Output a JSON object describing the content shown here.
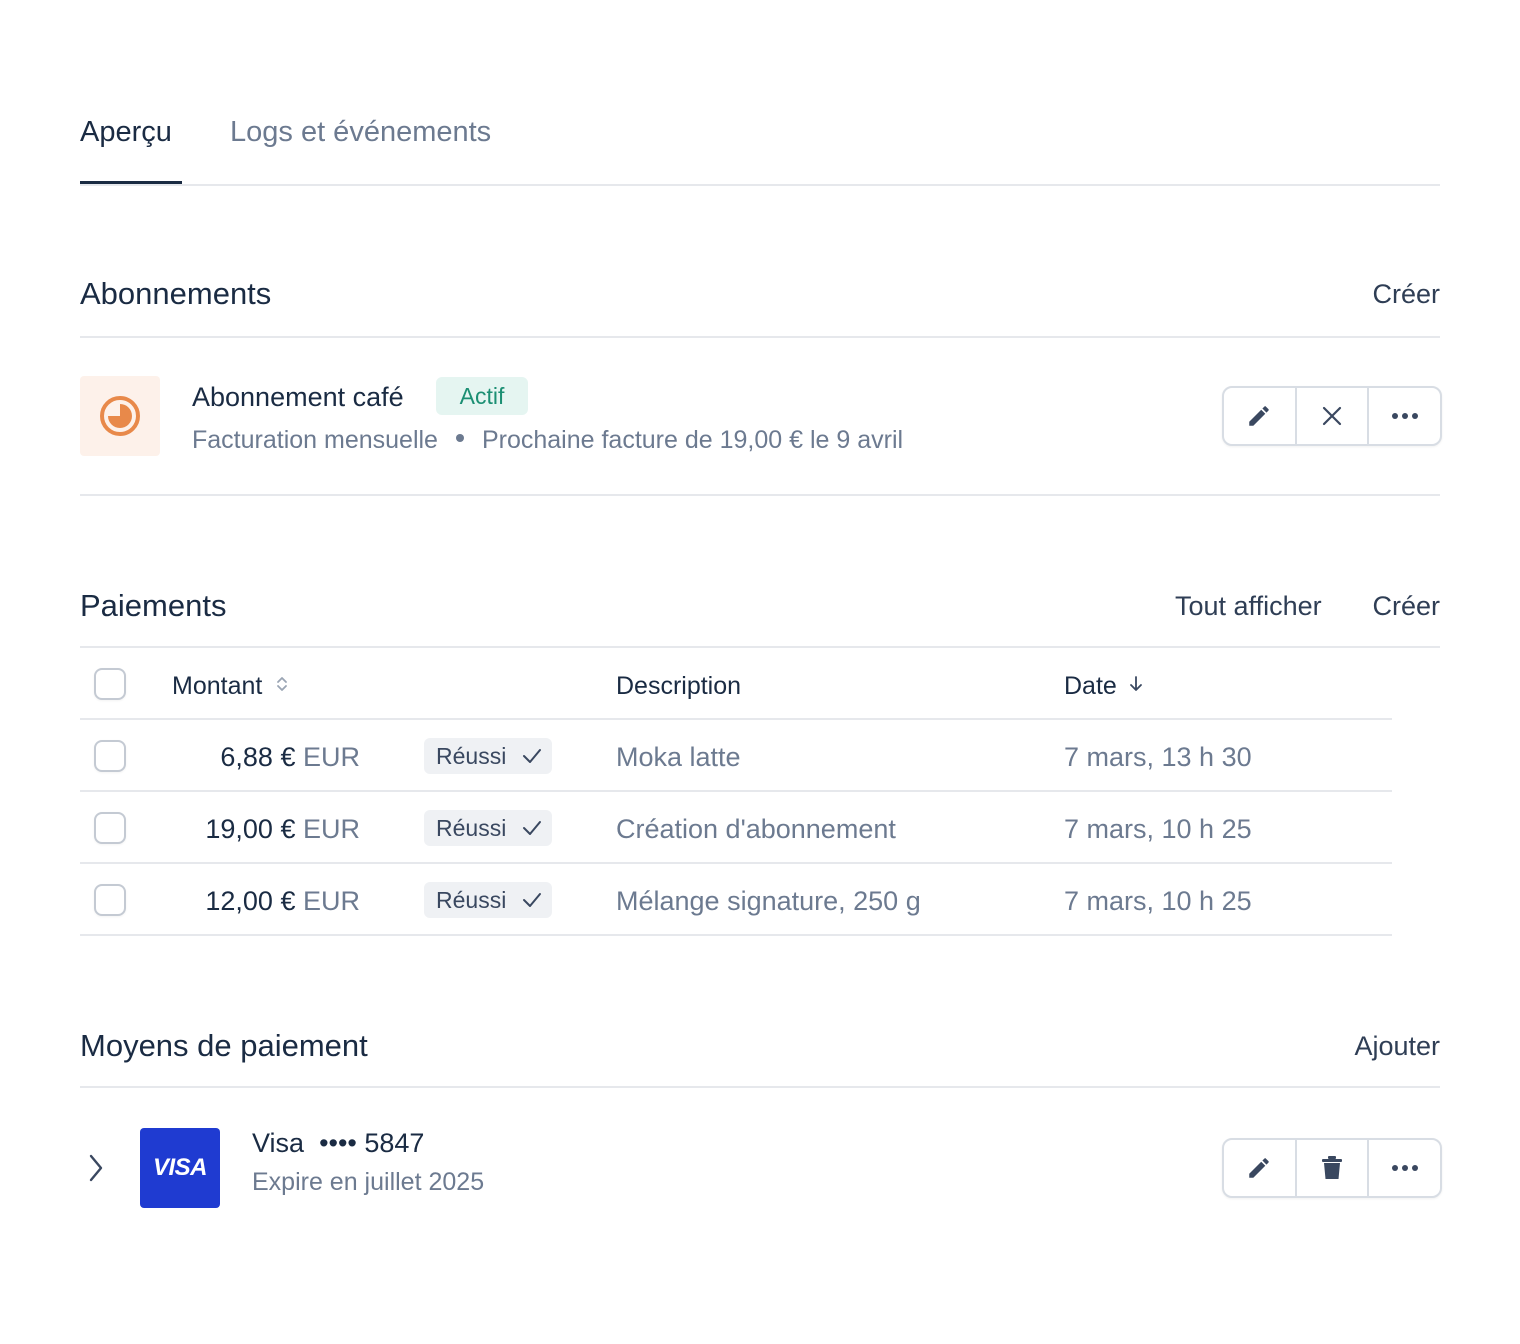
{
  "tabs": [
    {
      "label": "Aperçu",
      "active": true
    },
    {
      "label": "Logs et événements",
      "active": false
    }
  ],
  "subscriptions": {
    "title": "Abonnements",
    "create_label": "Créer",
    "item": {
      "name": "Abonnement café",
      "status": "Actif",
      "billing": "Facturation mensuelle",
      "next_invoice": "Prochaine facture de 19,00 € le 9 avril",
      "actions": [
        "pencil-icon",
        "close-icon",
        "more-icon"
      ]
    }
  },
  "payments": {
    "title": "Paiements",
    "view_all_label": "Tout afficher",
    "create_label": "Créer",
    "columns": {
      "amount": "Montant",
      "description": "Description",
      "date": "Date"
    },
    "rows": [
      {
        "amount": "6,88 €",
        "currency": "EUR",
        "status": "Réussi",
        "description": "Moka latte",
        "date": "7 mars, 13 h 30"
      },
      {
        "amount": "19,00 €",
        "currency": "EUR",
        "status": "Réussi",
        "description": "Création d'abonnement",
        "date": "7 mars, 10 h 25"
      },
      {
        "amount": "12,00 €",
        "currency": "EUR",
        "status": "Réussi",
        "description": "Mélange signature, 250 g",
        "date": "7 mars, 10 h 25"
      }
    ]
  },
  "payment_methods": {
    "title": "Moyens de paiement",
    "add_label": "Ajouter",
    "item": {
      "brand": "VISA",
      "name": "Visa",
      "masked": "•••• 5847",
      "expiry": "Expire en juillet 2025",
      "actions": [
        "pencil-icon",
        "trash-icon",
        "more-icon"
      ]
    }
  },
  "colors": {
    "text": "#1a2b43",
    "muted": "#6c7a90",
    "success": "#1b8f73",
    "accent_orange": "#e8894a",
    "visa_blue": "#1f3bd1"
  }
}
